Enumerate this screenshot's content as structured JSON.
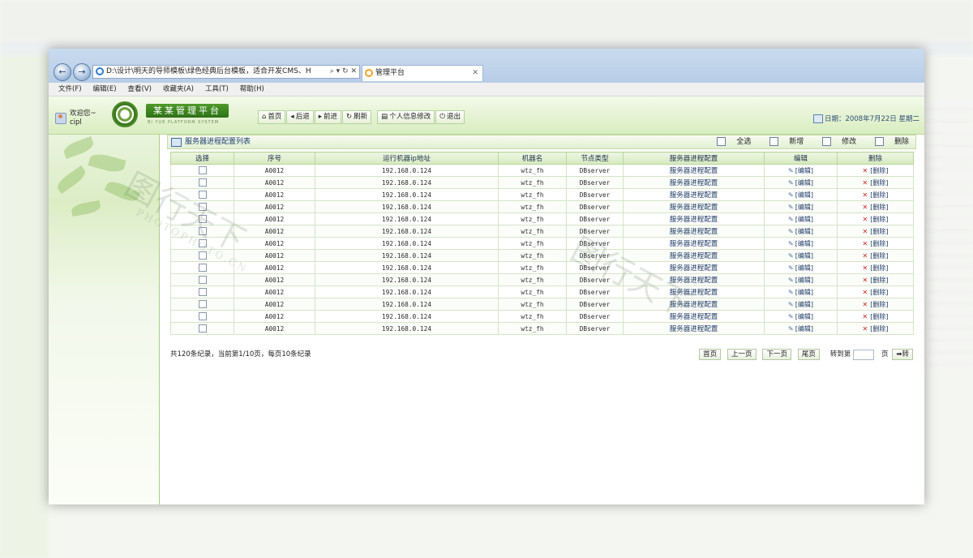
{
  "browser": {
    "address": "D:\\设计\\明天的导师模板\\绿色经典后台模板，适合开发CMS、H",
    "address_controls": "⌕ ▾ ↻ ✕",
    "tab_title": "管理平台",
    "back_glyph": "←",
    "forward_glyph": "→"
  },
  "menu": [
    "文件(F)",
    "编辑(E)",
    "查看(V)",
    "收藏夹(A)",
    "工具(T)",
    "帮助(H)"
  ],
  "header": {
    "welcome_line1": "欢迎您~",
    "welcome_line2": "cipl",
    "logo_title": "某某管理平台",
    "logo_subtitle": "BI YUE PLATFORM SYSTEM",
    "nav": [
      {
        "icon": "home-icon",
        "glyph": "⌂",
        "label": "首页"
      },
      {
        "icon": "back-icon",
        "glyph": "◂",
        "label": "后退"
      },
      {
        "icon": "forward-icon",
        "glyph": "▸",
        "label": "前进"
      },
      {
        "icon": "refresh-icon",
        "glyph": "↻",
        "label": "刷新"
      },
      {
        "icon": "profile-icon",
        "glyph": "▤",
        "label": "个人信息修改"
      },
      {
        "icon": "logout-icon",
        "glyph": "⏻",
        "label": "退出"
      }
    ],
    "date": "日期：2008年7月22日 星期二"
  },
  "panel": {
    "title": "服务器进程配置列表",
    "actions": {
      "select_all": "全选",
      "add": "新增",
      "edit": "修改",
      "delete": "删除"
    },
    "columns": [
      "选择",
      "序号",
      "运行机器ip地址",
      "机器名",
      "节点类型",
      "服务器进程配置",
      "编辑",
      "删除"
    ],
    "row_count": 14,
    "row_values": {
      "id": "A0012",
      "ip": "192.168.0.124",
      "machine": "wtz_fh",
      "node": "DBserver",
      "config": "服务器进程配置",
      "edit": "[编辑]",
      "delete": "[删除]"
    },
    "edit_glyph": "✎",
    "delete_glyph": "✕"
  },
  "pager": {
    "info": "共120条纪录，当前第1/10页，每页10条纪录",
    "first": "首页",
    "prev": "上一页",
    "next": "下一页",
    "last": "尾页",
    "goto_label": "转到第",
    "page_label": "页",
    "go": "➡转"
  },
  "watermark": {
    "text": "图行天下",
    "latin": "PHOTOPHOTO.CN"
  }
}
